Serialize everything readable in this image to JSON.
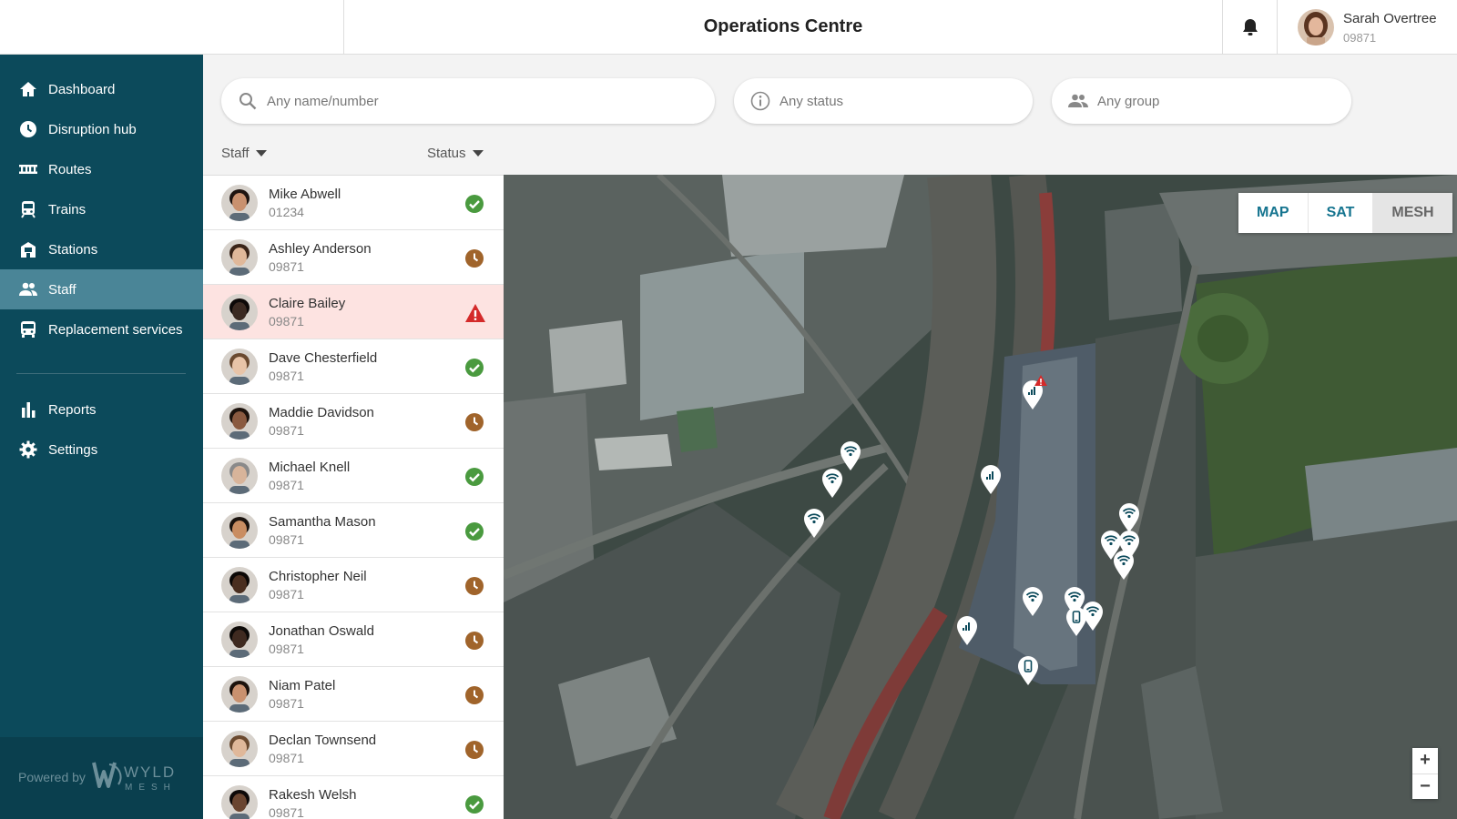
{
  "header": {
    "title": "Operations Centre",
    "user": {
      "name": "Sarah Overtree",
      "number": "09871"
    }
  },
  "sidebar": {
    "items": [
      {
        "label": "Dashboard",
        "icon": "home-icon"
      },
      {
        "label": "Disruption hub",
        "icon": "clock-icon"
      },
      {
        "label": "Routes",
        "icon": "track-icon"
      },
      {
        "label": "Trains",
        "icon": "train-icon"
      },
      {
        "label": "Stations",
        "icon": "station-icon"
      },
      {
        "label": "Staff",
        "icon": "people-icon",
        "active": true
      },
      {
        "label": "Replacement services",
        "icon": "bus-icon"
      },
      {
        "label": "Reports",
        "icon": "bar-chart-icon"
      },
      {
        "label": "Settings",
        "icon": "gear-icon"
      }
    ],
    "powered_by": "Powered by",
    "logo_text": "WYLD",
    "logo_sub": "MESH"
  },
  "filters": {
    "name_placeholder": "Any name/number",
    "status_placeholder": "Any status",
    "group_placeholder": "Any group"
  },
  "columns": {
    "staff": "Staff",
    "status": "Status"
  },
  "staff": [
    {
      "name": "Mike Abwell",
      "number": "01234",
      "status": "ok"
    },
    {
      "name": "Ashley Anderson",
      "number": "09871",
      "status": "pending"
    },
    {
      "name": "Claire Bailey",
      "number": "09871",
      "status": "alert"
    },
    {
      "name": "Dave Chesterfield",
      "number": "09871",
      "status": "ok"
    },
    {
      "name": "Maddie Davidson",
      "number": "09871",
      "status": "pending"
    },
    {
      "name": "Michael Knell",
      "number": "09871",
      "status": "ok"
    },
    {
      "name": "Samantha Mason",
      "number": "09871",
      "status": "ok"
    },
    {
      "name": "Christopher Neil",
      "number": "09871",
      "status": "pending"
    },
    {
      "name": "Jonathan Oswald",
      "number": "09871",
      "status": "pending"
    },
    {
      "name": "Niam Patel",
      "number": "09871",
      "status": "pending"
    },
    {
      "name": "Declan Townsend",
      "number": "09871",
      "status": "pending"
    },
    {
      "name": "Rakesh Welsh",
      "number": "09871",
      "status": "ok"
    }
  ],
  "map": {
    "modes": [
      "MAP",
      "SAT",
      "MESH"
    ],
    "selected_mode": "MESH",
    "zoom_in": "+",
    "zoom_out": "−"
  },
  "colors": {
    "sidebar": "#0c4a5b",
    "sidebar_active": "#4a8597",
    "ok": "#4a9a3f",
    "pending": "#a0642b",
    "alert": "#d42a2a",
    "accent": "#15748f"
  }
}
